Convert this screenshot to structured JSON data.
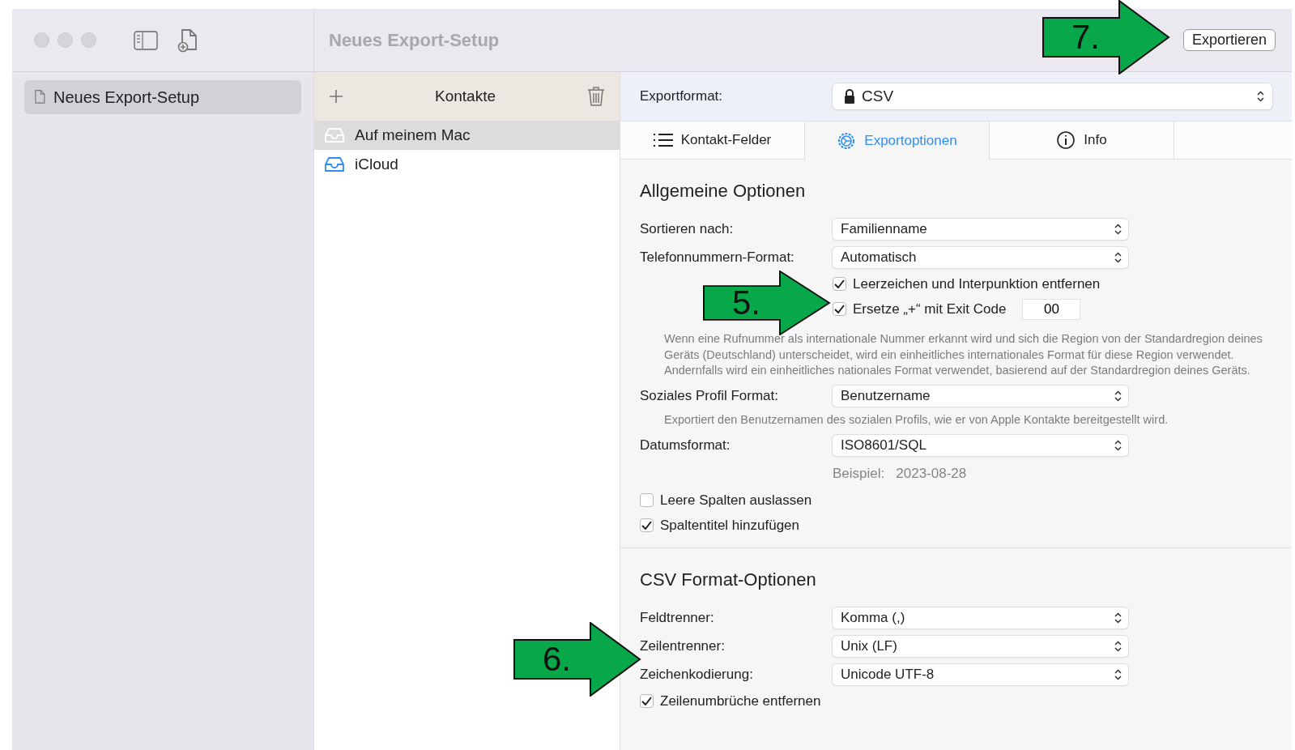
{
  "window": {
    "title": "Neues Export-Setup"
  },
  "export_button": {
    "label": "Exportieren"
  },
  "sidebar": {
    "items": [
      {
        "label": "Neues Export-Setup",
        "selected": true
      }
    ]
  },
  "sources": {
    "title": "Kontakte",
    "items": [
      {
        "label": "Auf meinem Mac",
        "selected": true
      },
      {
        "label": "iCloud",
        "selected": false
      }
    ]
  },
  "export_format": {
    "label": "Exportformat:",
    "value": "CSV"
  },
  "tabs": [
    {
      "label": "Kontakt-Felder",
      "selected": false
    },
    {
      "label": "Exportoptionen",
      "selected": true
    },
    {
      "label": "Info",
      "selected": false
    }
  ],
  "sections": [
    {
      "title": "Allgemeine Optionen",
      "rows": [
        {
          "kind": "select",
          "label": "Sortieren nach:",
          "value": "Familienname"
        },
        {
          "kind": "select",
          "label": "Telefonnummern-Format:",
          "value": "Automatisch"
        },
        {
          "kind": "subcheck",
          "label": "Leerzeichen und Interpunktion entfernen",
          "checked": true
        },
        {
          "kind": "subcheck",
          "label": "Ersetze „+“ mit Exit Code",
          "checked": true,
          "value": "00"
        },
        {
          "kind": "note",
          "text": "Wenn eine Rufnummer als internationale Nummer erkannt wird und sich die Region von der Standardregion deines Geräts (Deutschland) unterscheidet, wird ein einheitliches internationales Format für diese Region verwendet. Andernfalls wird ein einheitliches nationales Format verwendet, basierend auf der Standardregion deines Geräts."
        },
        {
          "kind": "select",
          "label": "Soziales Profil Format:",
          "value": "Benutzername"
        },
        {
          "kind": "note",
          "text": "Exportiert den Benutzernamen des sozialen Profils, wie er von Apple Kontakte bereitgestellt wird."
        },
        {
          "kind": "select",
          "label": "Datumsformat:",
          "value": "ISO8601/SQL"
        },
        {
          "kind": "example",
          "label": "Beispiel:",
          "value": "2023-08-28"
        },
        {
          "kind": "checkbox",
          "label": "Leere Spalten auslassen",
          "checked": false
        },
        {
          "kind": "checkbox",
          "label": "Spaltentitel hinzufügen",
          "checked": true
        }
      ]
    },
    {
      "title": "CSV Format-Optionen",
      "rows": [
        {
          "kind": "select",
          "label": "Feldtrenner:",
          "value": "Komma (,)"
        },
        {
          "kind": "select",
          "label": "Zeilentrenner:",
          "value": "Unix (LF)"
        },
        {
          "kind": "select",
          "label": "Zeichenkodierung:",
          "value": "Unicode UTF-8"
        },
        {
          "kind": "checkbox",
          "label": "Zeilenumbrüche entfernen",
          "checked": true
        }
      ]
    }
  ],
  "callouts": [
    {
      "number": "7."
    },
    {
      "number": "5."
    },
    {
      "number": "6."
    }
  ]
}
